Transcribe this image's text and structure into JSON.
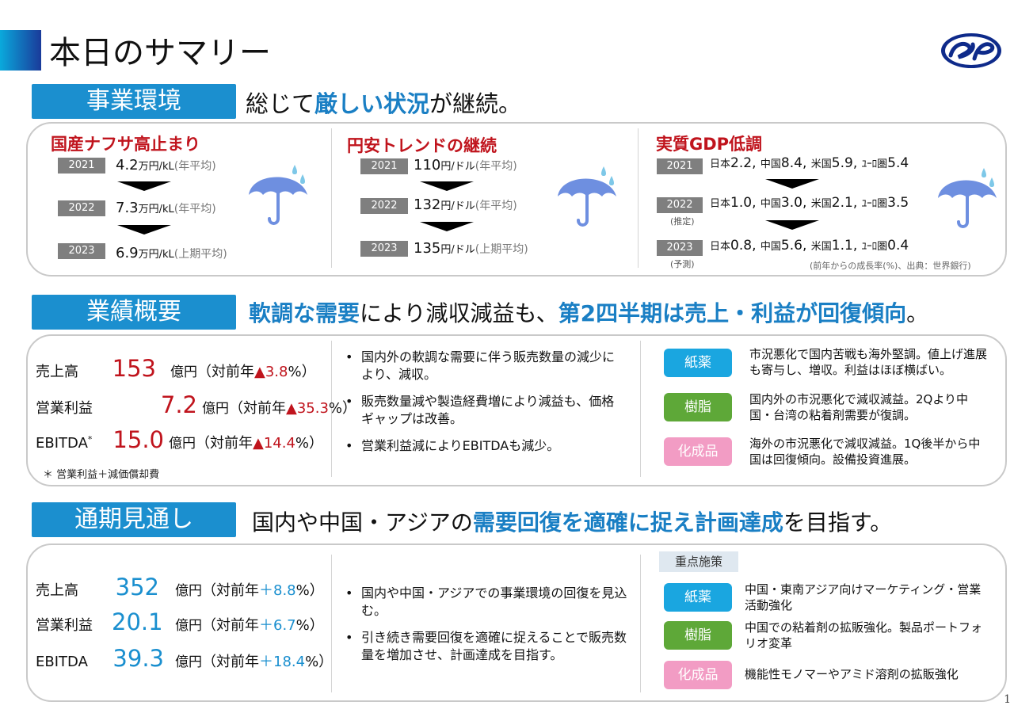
{
  "title": "本日のサマリー",
  "page_number": "1",
  "section1": {
    "label": "事業環境",
    "headline_pre": "総じて",
    "headline_hl": "厳しい状況",
    "headline_post": "が継続。",
    "col1": {
      "title": "国産ナフサ高止まり",
      "rows": [
        {
          "year": "2021",
          "value": "4.2",
          "unit": "万円/kL",
          "note": "(年平均)"
        },
        {
          "year": "2022",
          "value": "7.3",
          "unit": "万円/kL",
          "note": "(年平均)"
        },
        {
          "year": "2023",
          "value": "6.9",
          "unit": "万円/kL",
          "note": "(上期平均)"
        }
      ]
    },
    "col2": {
      "title": "円安トレンドの継続",
      "rows": [
        {
          "year": "2021",
          "value": "110",
          "unit": "円/ドル",
          "note": "(年平均)"
        },
        {
          "year": "2022",
          "value": "132",
          "unit": "円/ドル",
          "note": "(年平均)"
        },
        {
          "year": "2023",
          "value": "135",
          "unit": "円/ドル",
          "note": "(上期平均)"
        }
      ]
    },
    "col3": {
      "title": "実質GDP低調",
      "rows": [
        {
          "year": "2021",
          "sub": "",
          "jp": "2.2",
          "cn": "8.4",
          "us": "5.9",
          "eu": "5.4"
        },
        {
          "year": "2022",
          "sub": "(推定)",
          "jp": "1.0",
          "cn": "3.0",
          "us": "2.1",
          "eu": "3.5"
        },
        {
          "year": "2023",
          "sub": "(予測)",
          "jp": "0.8",
          "cn": "5.6",
          "us": "1.1",
          "eu": "0.4"
        }
      ],
      "labels": {
        "jp": "日本",
        "cn": "中国",
        "us": "米国",
        "eu": "ﾕｰﾛ圏"
      },
      "source": "(前年からの成長率(%)、出典：世界銀行)"
    }
  },
  "section2": {
    "label": "業績概要",
    "headline_hl1": "軟調な需要",
    "headline_mid": "により減収減益も、",
    "headline_hl2": "第2四半期は売上・利益が回復傾向",
    "headline_end": "。",
    "metrics": [
      {
        "label": "売上高",
        "value": "153",
        "unit": "億円",
        "pre": "（対前年",
        "change": "▲3.8",
        "post": "%）"
      },
      {
        "label": "営業利益",
        "value": "7.2",
        "unit": "億円",
        "pre": "（対前年",
        "change": "▲35.3",
        "post": "%）"
      },
      {
        "label": "EBITDA",
        "sup": "*",
        "value": "15.0",
        "unit": "億円",
        "pre": "（対前年",
        "change": "▲14.4",
        "post": "%）"
      }
    ],
    "footnote": "＊ 営業利益＋減価償却費",
    "bullets": [
      "国内外の軟調な需要に伴う販売数量の減少により、減収。",
      "販売数量減や製造経費増により減益も、価格ギャップは改善。",
      "営業利益減によりEBITDAも減少。"
    ],
    "segments": [
      {
        "name": "紙薬",
        "text": "市況悪化で国内苦戦も海外堅調。値上げ進展も寄与し、増収。利益はほぼ横ばい。"
      },
      {
        "name": "樹脂",
        "text": "国内外の市況悪化で減収減益。2Qより中国・台湾の粘着剤需要が復調。"
      },
      {
        "name": "化成品",
        "text": "海外の市況悪化で減収減益。1Q後半から中国は回復傾向。設備投資進展。"
      }
    ]
  },
  "section3": {
    "label": "通期見通し",
    "headline_pre": "国内や中国・アジアの",
    "headline_hl": "需要回復を適確に捉え計画達成",
    "headline_post": "を目指す。",
    "metrics": [
      {
        "label": "売上高",
        "value": "352",
        "unit": "億円",
        "pre": "（対前年",
        "change": "＋8.8",
        "post": "%）"
      },
      {
        "label": "営業利益",
        "value": "20.1",
        "unit": "億円",
        "pre": "（対前年",
        "change": "＋6.7",
        "post": "%）"
      },
      {
        "label": "EBITDA",
        "value": "39.3",
        "unit": "億円",
        "pre": "（対前年",
        "change": "＋18.4",
        "post": "%）"
      }
    ],
    "bullets": [
      "国内や中国・アジアでの事業環境の回復を見込む。",
      "引き続き需要回復を適確に捉えることで販売数量を増加させ、計画達成を目指す。"
    ],
    "focus_label": "重点施策",
    "segments": [
      {
        "name": "紙薬",
        "text": "中国・東南アジア向けマーケティング・営業活動強化"
      },
      {
        "name": "樹脂",
        "text": "中国での粘着剤の拡販強化。製品ポートフォリオ変革"
      },
      {
        "name": "化成品",
        "text": "機能性モノマーやアミド溶剤の拡販強化"
      }
    ]
  },
  "colors": {
    "accent_blue": "#1b8fcf",
    "red": "#c0141d",
    "paper": "#1aa6e0",
    "resin": "#5ea838",
    "chem": "#f29cc4"
  },
  "icons": [
    "umbrella-icon",
    "company-logo",
    "down-arrow-icon"
  ]
}
